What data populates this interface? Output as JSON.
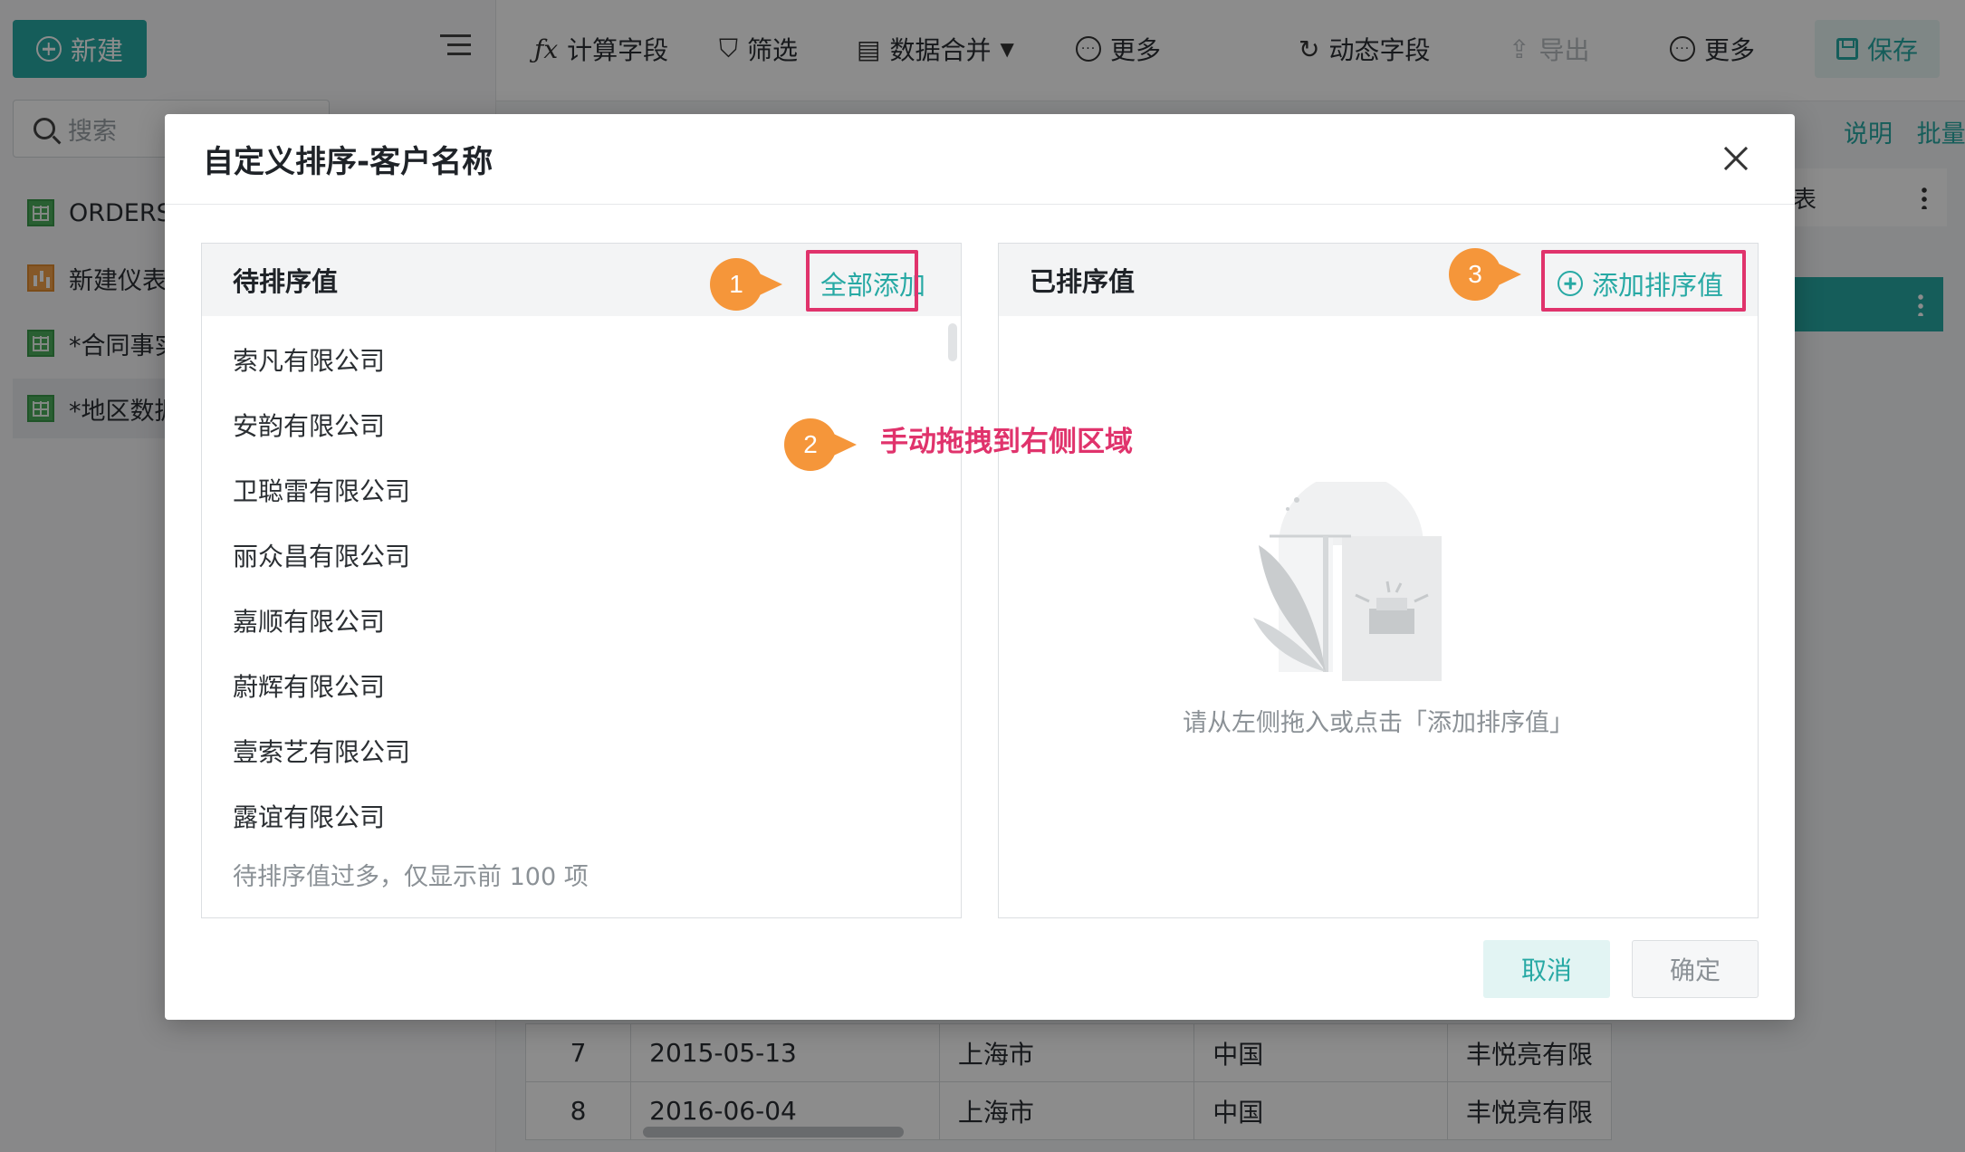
{
  "sidebar": {
    "new_label": "新建",
    "search_placeholder": "搜索",
    "items": [
      {
        "label": "ORDERS",
        "icon": "sheet-icon"
      },
      {
        "label": "新建仪表",
        "icon": "dashboard-icon"
      },
      {
        "label": "*合同事实",
        "icon": "sheet-icon"
      },
      {
        "label": "*地区数据",
        "icon": "sheet-icon"
      }
    ]
  },
  "toolbar": {
    "calc_field": "计算字段",
    "filter": "筛选",
    "merge": "数据合并",
    "more1": "更多",
    "dynamic_field": "动态字段",
    "export": "导出",
    "more2": "更多",
    "save": "保存"
  },
  "right_links": {
    "explain": "说明",
    "batch": "批量"
  },
  "right_panel": {
    "row1": "表"
  },
  "table": {
    "rows": [
      [
        "7",
        "2015-05-13",
        "上海市",
        "中国",
        "丰悦亮有限"
      ],
      [
        "8",
        "2016-06-04",
        "上海市",
        "中国",
        "丰悦亮有限"
      ]
    ]
  },
  "modal": {
    "title": "自定义排序-客户名称",
    "left": {
      "title": "待排序值",
      "add_all": "全部添加",
      "items": [
        "索凡有限公司",
        "安韵有限公司",
        "卫聪雷有限公司",
        "丽众昌有限公司",
        "嘉顺有限公司",
        "蔚辉有限公司",
        "壹索艺有限公司",
        "露谊有限公司"
      ],
      "note": "待排序值过多，仅显示前 100 项"
    },
    "right": {
      "title": "已排序值",
      "add_sorted": "添加排序值",
      "empty_text": "请从左侧拖入或点击「添加排序值」"
    },
    "cancel": "取消",
    "ok": "确定"
  },
  "annotations": {
    "badge1": "1",
    "badge2": "2",
    "badge3": "3",
    "drag_hint": "手动拖拽到右侧区域"
  },
  "colors": {
    "accent": "#27a9a4",
    "highlight": "#e0336c",
    "badge": "#f5963a"
  }
}
